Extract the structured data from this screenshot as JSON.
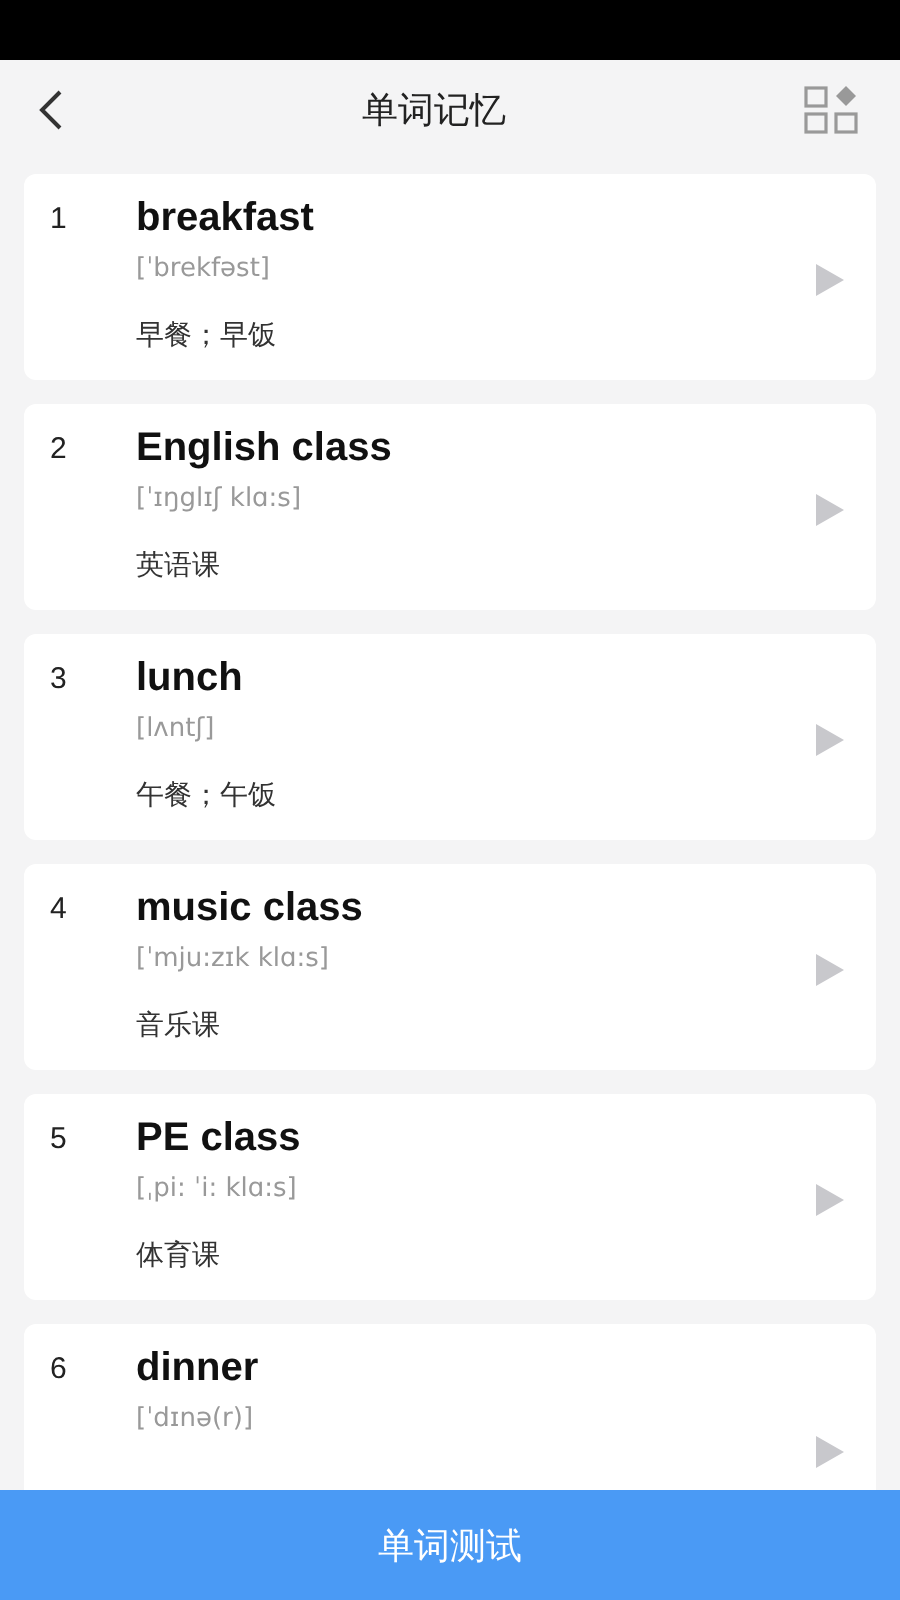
{
  "header": {
    "title": "单词记忆"
  },
  "words": [
    {
      "number": "1",
      "word": "breakfast",
      "phonetic": "[ˈbrekfəst]",
      "meaning": "早餐；早饭"
    },
    {
      "number": "2",
      "word": "English class",
      "phonetic": "[ˈɪŋglɪʃ klɑ:s]",
      "meaning": "英语课"
    },
    {
      "number": "3",
      "word": "lunch",
      "phonetic": "[lʌntʃ]",
      "meaning": "午餐；午饭"
    },
    {
      "number": "4",
      "word": "music class",
      "phonetic": "[ˈmju:zɪk klɑ:s]",
      "meaning": "音乐课"
    },
    {
      "number": "5",
      "word": "PE class",
      "phonetic": "[ˌpi: ˈi:  klɑ:s]",
      "meaning": "体育课"
    },
    {
      "number": "6",
      "word": "dinner",
      "phonetic": "[ˈdɪnə(r)]"
    }
  ],
  "bottom_button": {
    "label": "单词测试"
  }
}
